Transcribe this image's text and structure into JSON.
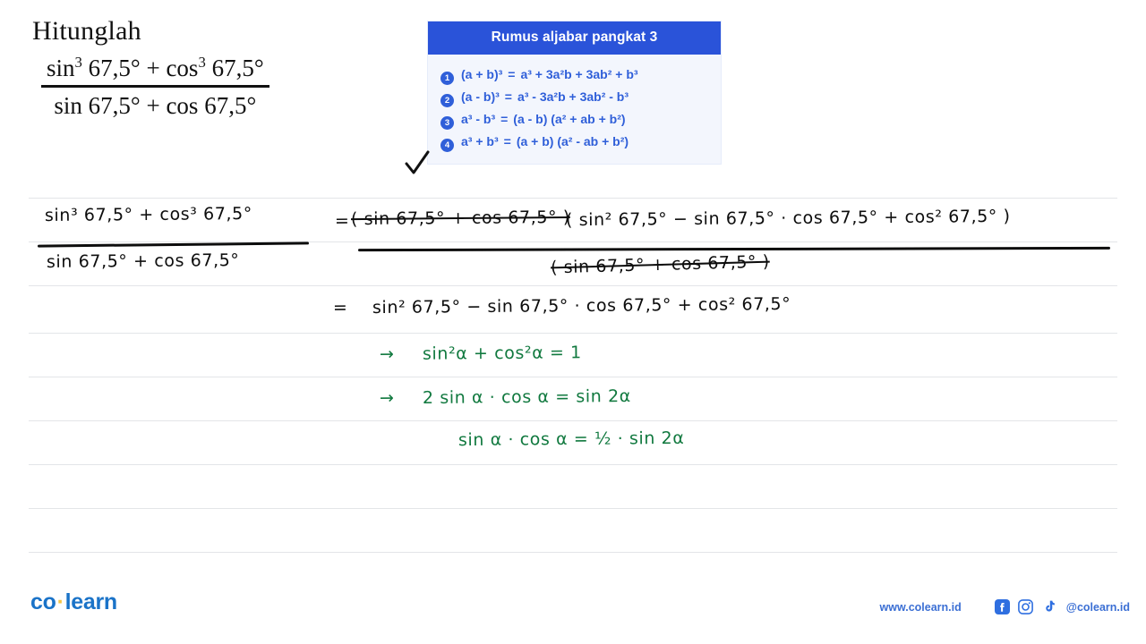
{
  "question": {
    "prompt": "Hitunglah",
    "numerator": "sin³ 67,5° + cos³ 67,5°",
    "numerator_parts": {
      "fn1": "sin",
      "pow1": "3",
      "arg1": " 67,5°",
      "op": " + ",
      "fn2": "cos",
      "pow2": "3",
      "arg2": " 67,5°"
    },
    "denominator": "sin 67,5° + cos 67,5°",
    "denominator_parts": {
      "fn1": "sin",
      "arg1": " 67,5°",
      "op": " + ",
      "fn2": "cos",
      "arg2": " 67,5°"
    }
  },
  "formula_card": {
    "title": "Rumus aljabar pangkat 3",
    "header_color": "#2a53d9",
    "body_color": "#f3f6fd",
    "text_color": "#2f5fd9",
    "items": [
      {
        "badge": "1",
        "lhs": "(a + b)³",
        "eq": "=",
        "rhs": "a³ + 3a²b + 3ab² + b³"
      },
      {
        "badge": "2",
        "lhs": "(a - b)³",
        "eq": "=",
        "rhs": "a³ - 3a²b + 3ab² - b³"
      },
      {
        "badge": "3",
        "lhs": "a³ - b³",
        "eq": "=",
        "rhs": "(a - b) (a² + ab + b²)"
      },
      {
        "badge": "4",
        "lhs": "a³ + b³",
        "eq": "=",
        "rhs": "(a + b) (a² - ab + b²)"
      }
    ]
  },
  "checkmark": {
    "name": "check-mark",
    "color": "#111111"
  },
  "work": {
    "line1": {
      "lhs_numerator": "sin³ 67,5° + cos³ 67,5°",
      "lhs_denominator": "sin 67,5° + cos 67,5°",
      "equals": "=",
      "rhs_numerator_cancelled": "( sin 67,5° + cos 67,5° )",
      "rhs_numerator_kept": "( sin² 67,5° −  sin 67,5° · cos 67,5° + cos² 67,5° )",
      "rhs_denominator_cancelled": "( sin 67,5° +   cos 67,5° )"
    },
    "line2": {
      "equals": "=",
      "expression": "sin² 67,5° −  sin 67,5° · cos 67,5° + cos² 67,5°"
    },
    "notes": [
      {
        "arrow": "→",
        "text": "sin²α + cos²α  =  1",
        "color": "#11793f"
      },
      {
        "arrow": "→",
        "text": "2 sin α · cos α  =  sin 2α",
        "color": "#11793f"
      },
      {
        "arrow": "",
        "text": "sin α · cos α  =  ½ ·  sin 2α",
        "color": "#11793f"
      }
    ]
  },
  "footer": {
    "logo_first": "co",
    "logo_dot": "·",
    "logo_second": "learn",
    "website": "www.colearn.id",
    "handle": "@colearn.id",
    "socials": [
      "facebook-icon",
      "instagram-icon",
      "tiktok-icon"
    ]
  }
}
